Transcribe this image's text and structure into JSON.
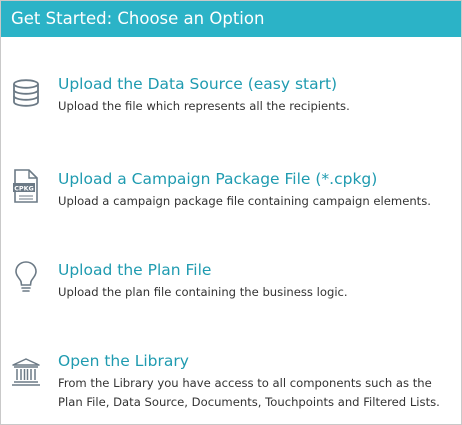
{
  "header": {
    "title": "Get Started: Choose an Option"
  },
  "options": [
    {
      "icon": "database-icon",
      "title": "Upload the Data Source (easy start)",
      "description": "Upload the file which represents all the recipients."
    },
    {
      "icon": "cpkg-file-icon",
      "icon_label": "CPKG",
      "title": "Upload a Campaign Package File (*.cpkg)",
      "description": "Upload a campaign package file containing campaign elements."
    },
    {
      "icon": "lightbulb-icon",
      "title": "Upload the Plan File",
      "description": "Upload the plan file containing the business logic."
    },
    {
      "icon": "library-icon",
      "title": "Open the Library",
      "description": "From the Library you have access to all components such as the Plan File, Data Source, Documents, Touchpoints and Filtered Lists."
    }
  ],
  "colors": {
    "header_bg": "#2bb3c7",
    "link": "#1f9bb0",
    "icon": "#6c7a86",
    "text": "#333333"
  }
}
